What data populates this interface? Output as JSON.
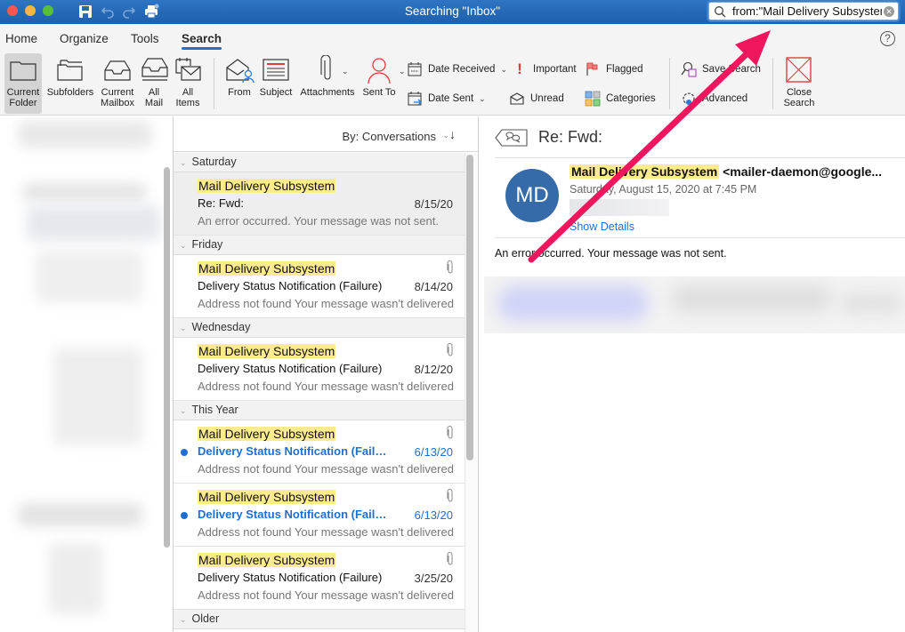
{
  "window": {
    "title": "Searching \"Inbox\"",
    "search_query": "from:\"Mail Delivery Subsystem\""
  },
  "toolbar_icons": [
    "save-icon",
    "undo-icon",
    "redo-icon",
    "print-icon"
  ],
  "tabs": [
    {
      "label": "Home",
      "active": false
    },
    {
      "label": "Organize",
      "active": false
    },
    {
      "label": "Tools",
      "active": false
    },
    {
      "label": "Search",
      "active": true
    }
  ],
  "ribbon": {
    "scope": [
      {
        "label": "Current\nFolder",
        "l1": "Current",
        "l2": "Folder",
        "selected": true
      },
      {
        "label": "Subfolders",
        "l1": "Subfolders",
        "l2": ""
      },
      {
        "label": "Current Mailbox",
        "l1": "Current",
        "l2": "Mailbox"
      },
      {
        "label": "All Mail",
        "l1": "All",
        "l2": "Mail"
      },
      {
        "label": "All Items",
        "l1": "All",
        "l2": "Items"
      }
    ],
    "filters": {
      "from": "From",
      "subject": "Subject",
      "attachments": "Attachments",
      "sent_to": "Sent To",
      "date_received": "Date Received",
      "date_sent": "Date Sent",
      "important": "Important",
      "unread": "Unread",
      "flagged": "Flagged",
      "categories": "Categories"
    },
    "save_search": "Save Search",
    "advanced": "Advanced",
    "close_search_l1": "Close",
    "close_search_l2": "Search"
  },
  "message_list": {
    "sort_label": "By: Conversations",
    "groups": [
      {
        "label": "Saturday",
        "messages": [
          {
            "sender": "Mail Delivery Subsystem",
            "subject": "Re: Fwd:",
            "date": "8/15/20",
            "preview": "An error occurred. Your message was not sent.",
            "attachment": false,
            "unread": false,
            "selected": true
          }
        ]
      },
      {
        "label": "Friday",
        "messages": [
          {
            "sender": "Mail Delivery Subsystem",
            "subject": "Delivery Status Notification (Failure)",
            "date": "8/14/20",
            "preview": "Address not found Your message wasn't delivered",
            "attachment": true,
            "unread": false
          }
        ]
      },
      {
        "label": "Wednesday",
        "messages": [
          {
            "sender": "Mail Delivery Subsystem",
            "subject": "Delivery Status Notification (Failure)",
            "date": "8/12/20",
            "preview": "Address not found Your message wasn't delivered",
            "attachment": true,
            "unread": false
          }
        ]
      },
      {
        "label": "This Year",
        "messages": [
          {
            "sender": "Mail Delivery Subsystem",
            "subject": "Delivery Status Notification (Failure)",
            "date": "6/13/20",
            "preview": "Address not found Your message wasn't delivered",
            "attachment": true,
            "unread": true
          },
          {
            "sender": "Mail Delivery Subsystem",
            "subject": "Delivery Status Notification (Failure)",
            "date": "6/13/20",
            "preview": "Address not found Your message wasn't delivered",
            "attachment": true,
            "unread": true
          },
          {
            "sender": "Mail Delivery Subsystem",
            "subject": "Delivery Status Notification (Failure)",
            "date": "3/25/20",
            "preview": "Address not found Your message wasn't delivered",
            "attachment": true,
            "unread": false
          }
        ]
      },
      {
        "label": "Older",
        "messages": []
      }
    ]
  },
  "reading_pane": {
    "subject": "Re: Fwd:",
    "sender_name": "Mail Delivery Subsystem",
    "sender_email": "<mailer-daemon@google...",
    "avatar_initials": "MD",
    "date": "Saturday, August 15, 2020 at 7:45 PM",
    "show_details": "Show Details",
    "body": "An error occurred. Your message was not sent."
  },
  "colors": {
    "titlebar": "#1d5fab",
    "accent": "#1f6fd1",
    "highlight": "#fdeb8f",
    "avatar": "#356ba8",
    "annotation_arrow": "#f0165e"
  }
}
